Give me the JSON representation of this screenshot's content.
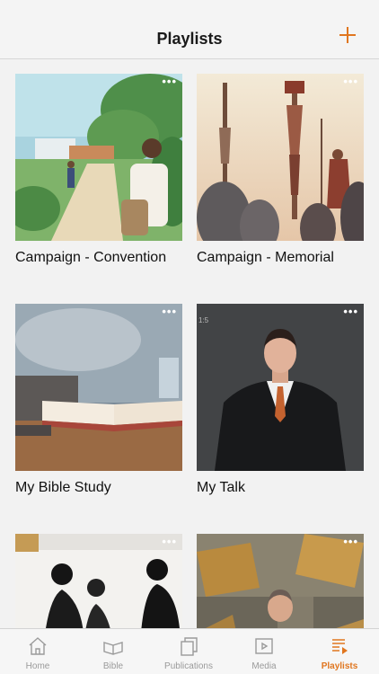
{
  "header": {
    "title": "Playlists",
    "add_icon": "plus-icon"
  },
  "playlists": [
    {
      "title": "Campaign - Convention",
      "menu_icon": "more-dots-icon"
    },
    {
      "title": "Campaign - Memorial",
      "menu_icon": "more-dots-icon"
    },
    {
      "title": "My Bible Study",
      "menu_icon": "more-dots-icon"
    },
    {
      "title": "My Talk",
      "menu_icon": "more-dots-icon",
      "overlay_text": "1:5"
    },
    {
      "title": "",
      "menu_icon": "more-dots-icon"
    },
    {
      "title": "",
      "menu_icon": "more-dots-icon"
    }
  ],
  "tabs": [
    {
      "label": "Home",
      "icon": "home-icon",
      "active": false
    },
    {
      "label": "Bible",
      "icon": "bible-icon",
      "active": false
    },
    {
      "label": "Publications",
      "icon": "publications-icon",
      "active": false
    },
    {
      "label": "Media",
      "icon": "media-icon",
      "active": false
    },
    {
      "label": "Playlists",
      "icon": "playlists-icon",
      "active": true
    }
  ],
  "colors": {
    "accent": "#e0761f",
    "inactive": "#9a9a9a",
    "background": "#f2f2f2"
  }
}
